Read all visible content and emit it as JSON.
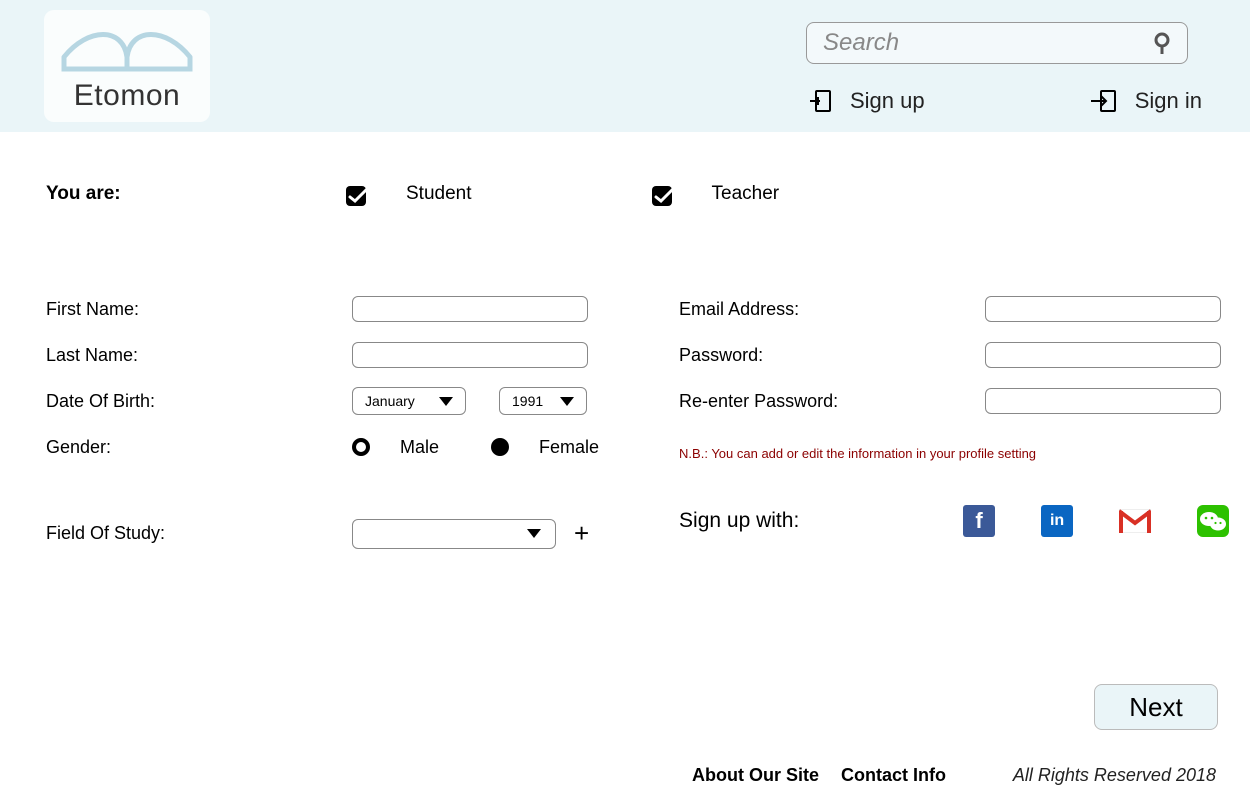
{
  "brand": "Etomon",
  "search_placeholder": "Search",
  "auth": {
    "signup": "Sign up",
    "signin": "Sign in"
  },
  "you_are_label": "You are:",
  "roles": {
    "student": "Student",
    "teacher": "Teacher"
  },
  "labels": {
    "first_name": "First Name:",
    "last_name": "Last Name:",
    "dob": "Date Of Birth:",
    "gender": "Gender:",
    "field_of_study": "Field Of Study:",
    "email": "Email Address:",
    "password": "Password:",
    "repassword": "Re-enter Password:"
  },
  "dob": {
    "month": "January",
    "year": "1991"
  },
  "gender": {
    "male": "Male",
    "female": "Female",
    "selected": "female"
  },
  "nb": "N.B.: You can add or edit the information in your profile setting",
  "social_label": "Sign up with:",
  "social": {
    "facebook": "facebook",
    "linkedin": "linkedin",
    "gmail": "gmail",
    "wechat": "wechat"
  },
  "next": "Next",
  "footer": {
    "about": "About Our Site",
    "contact": "Contact Info",
    "copyright": "All Rights Reserved 2018"
  }
}
